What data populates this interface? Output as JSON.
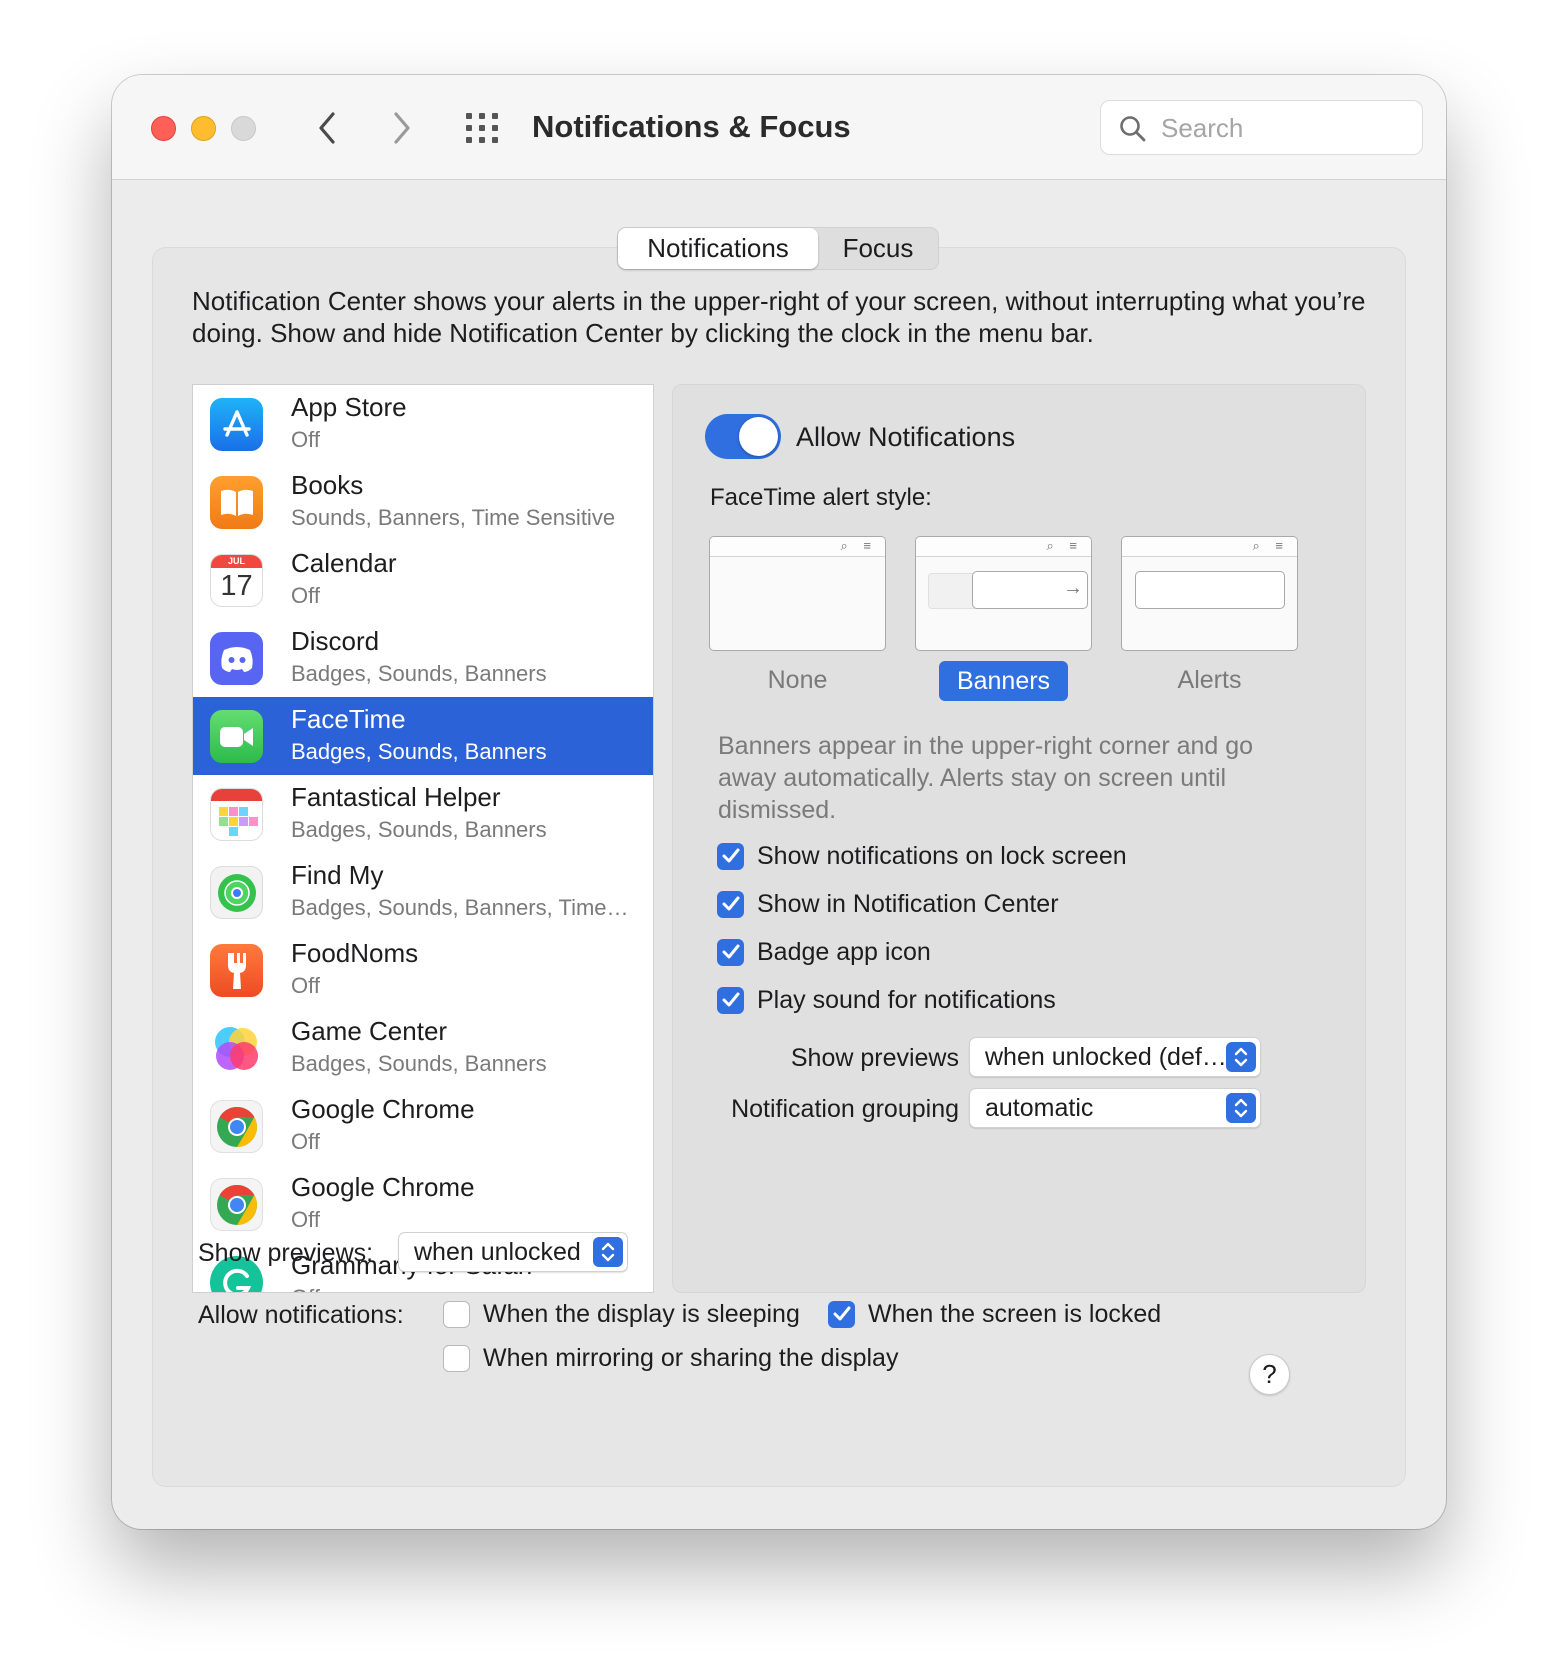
{
  "window": {
    "title": "Notifications & Focus",
    "search_placeholder": "Search"
  },
  "tabs": [
    {
      "label": "Notifications",
      "active": true
    },
    {
      "label": "Focus",
      "active": false
    }
  ],
  "description": "Notification Center shows your alerts in the upper-right of your screen, without interrupting what you’re doing. Show and hide Notification Center by clicking the clock in the menu bar.",
  "apps": [
    {
      "name": "App Store",
      "status": "Off",
      "icon": "app-store-icon"
    },
    {
      "name": "Books",
      "status": "Sounds, Banners, Time Sensitive",
      "icon": "books-icon"
    },
    {
      "name": "Calendar",
      "status": "Off",
      "icon": "calendar-icon",
      "icon_month": "JUL",
      "icon_day": "17"
    },
    {
      "name": "Discord",
      "status": "Badges, Sounds, Banners",
      "icon": "discord-icon"
    },
    {
      "name": "FaceTime",
      "status": "Badges, Sounds, Banners",
      "icon": "facetime-icon",
      "selected": true
    },
    {
      "name": "Fantastical Helper",
      "status": "Badges, Sounds, Banners",
      "icon": "fantastical-icon"
    },
    {
      "name": "Find My",
      "status": "Badges, Sounds, Banners, Time…",
      "icon": "find-my-icon"
    },
    {
      "name": "FoodNoms",
      "status": "Off",
      "icon": "foodnoms-icon"
    },
    {
      "name": "Game Center",
      "status": "Badges, Sounds, Banners",
      "icon": "game-center-icon"
    },
    {
      "name": "Google Chrome",
      "status": "Off",
      "icon": "chrome-icon"
    },
    {
      "name": "Google Chrome",
      "status": "Off",
      "icon": "chrome-icon"
    },
    {
      "name": "Grammarly for Safari",
      "status": "Off",
      "icon": "grammarly-icon"
    }
  ],
  "settings": {
    "allow_label": "Allow Notifications",
    "allow_enabled": true,
    "alert_style_heading": "FaceTime alert style:",
    "styles": [
      {
        "label": "None",
        "selected": false
      },
      {
        "label": "Banners",
        "selected": true
      },
      {
        "label": "Alerts",
        "selected": false
      }
    ],
    "style_description": "Banners appear in the upper-right corner and go away automatically. Alerts stay on screen until dismissed.",
    "checkboxes": [
      {
        "label": "Show notifications on lock screen",
        "checked": true
      },
      {
        "label": "Show in Notification Center",
        "checked": true
      },
      {
        "label": "Badge app icon",
        "checked": true
      },
      {
        "label": "Play sound for notifications",
        "checked": true
      }
    ],
    "show_previews_label": "Show previews",
    "show_previews_value": "when unlocked (def…",
    "grouping_label": "Notification grouping",
    "grouping_value": "automatic"
  },
  "footer": {
    "show_previews_label": "Show previews:",
    "show_previews_value": "when unlocked",
    "allow_label": "Allow notifications:",
    "options": [
      {
        "label": "When the display is sleeping",
        "checked": false
      },
      {
        "label": "When the screen is locked",
        "checked": true
      },
      {
        "label": "When mirroring or sharing the display",
        "checked": false
      }
    ],
    "help": "?"
  },
  "colors": {
    "accent": "#2f6fe0",
    "selection": "#2c62d8",
    "close": "#fe5f57",
    "minimize": "#febc2e",
    "zoom": "#d9d9d9"
  }
}
